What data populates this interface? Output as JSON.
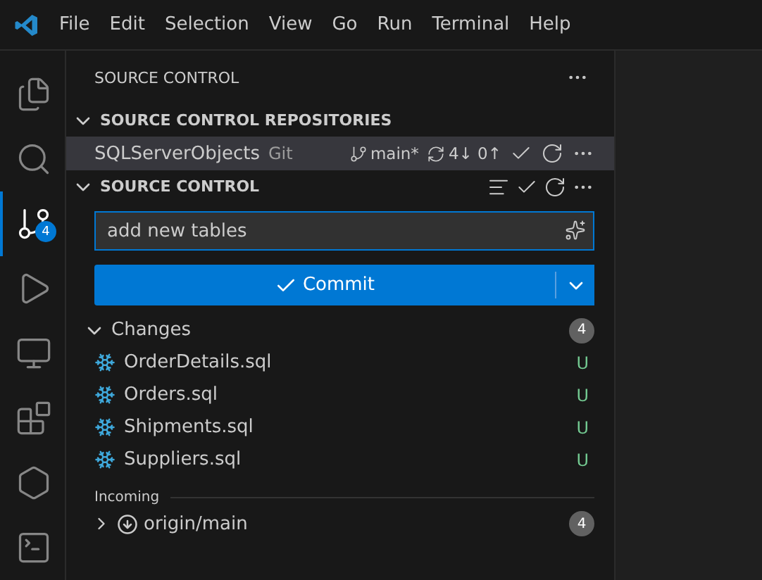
{
  "menu": [
    "File",
    "Edit",
    "Selection",
    "View",
    "Go",
    "Run",
    "Terminal",
    "Help"
  ],
  "activity_bar": [
    {
      "kind": "files",
      "selected": false
    },
    {
      "kind": "search",
      "selected": false
    },
    {
      "kind": "source-control",
      "selected": true,
      "badge": "4"
    },
    {
      "kind": "run",
      "selected": false
    },
    {
      "kind": "remote",
      "selected": false
    },
    {
      "kind": "extensions",
      "selected": false
    },
    {
      "kind": "hexagon",
      "selected": false
    },
    {
      "kind": "partial",
      "selected": false
    }
  ],
  "sidebar": {
    "title": "SOURCE CONTROL",
    "repositories": {
      "header": "SOURCE CONTROL REPOSITORIES",
      "expanded": true,
      "items": [
        {
          "name": "SQLServerObjects",
          "provider": "Git",
          "branch": "main*",
          "sync": "4↓ 0↑",
          "selected": true
        }
      ]
    },
    "source_control": {
      "header": "SOURCE CONTROL",
      "expanded": true,
      "message": {
        "value": "add new tables"
      },
      "commit_button": "Commit",
      "changes": {
        "label": "Changes",
        "expanded": true,
        "count": "4",
        "files": [
          {
            "name": "OrderDetails.sql",
            "status": "U"
          },
          {
            "name": "Orders.sql",
            "status": "U"
          },
          {
            "name": "Shipments.sql",
            "status": "U"
          },
          {
            "name": "Suppliers.sql",
            "status": "U"
          }
        ]
      },
      "incoming": {
        "label": "Incoming",
        "items": [
          {
            "name": "origin/main",
            "expanded": false,
            "count": "4"
          }
        ]
      }
    }
  }
}
